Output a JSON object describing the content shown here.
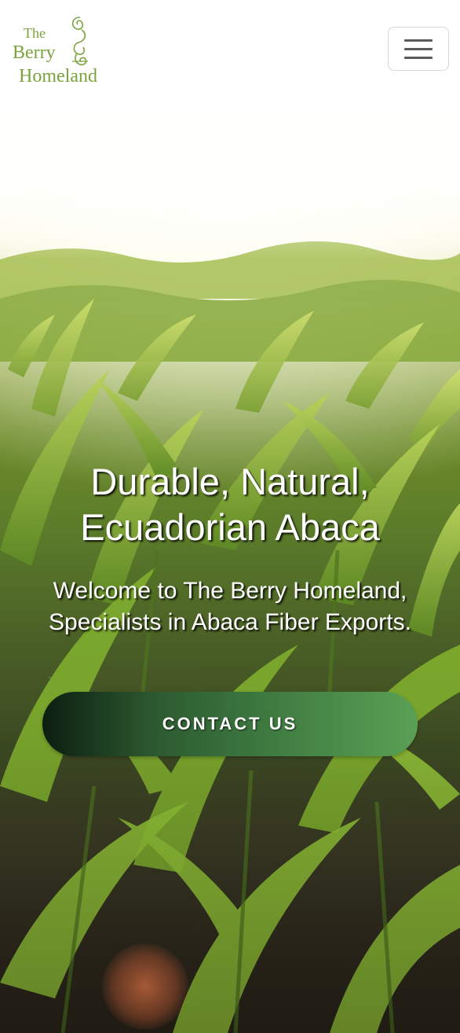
{
  "header": {
    "logo": {
      "line1": "The",
      "line2": "Berry",
      "line3": "Homeland"
    },
    "menu_icon": "hamburger-menu-icon"
  },
  "hero": {
    "title": "Durable, Natural, Ecuadorian Abaca",
    "subtitle": "Welcome to The Berry Homeland, Specialists in Abaca Fiber Exports.",
    "cta_label": "CONTACT US"
  },
  "colors": {
    "brand_green": "#7aa33c",
    "button_gradient_start": "#0c1d10",
    "button_gradient_end": "#5aa055"
  }
}
